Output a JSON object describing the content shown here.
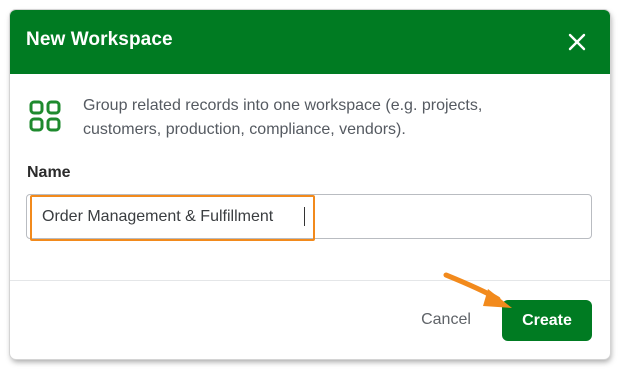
{
  "dialog": {
    "title": "New Workspace",
    "close_icon": "close-icon",
    "description_icon": "grid-icon",
    "description": "Group related records into one workspace (e.g. projects, customers, production, compliance, vendors).",
    "name_label": "Name",
    "name_value": "Order Management & Fulfillment",
    "cancel_label": "Cancel",
    "create_label": "Create"
  },
  "colors": {
    "header": "#007b22",
    "primary_button": "#007b22",
    "icon": "#1e8a2e",
    "highlight": "#f28a1c"
  }
}
